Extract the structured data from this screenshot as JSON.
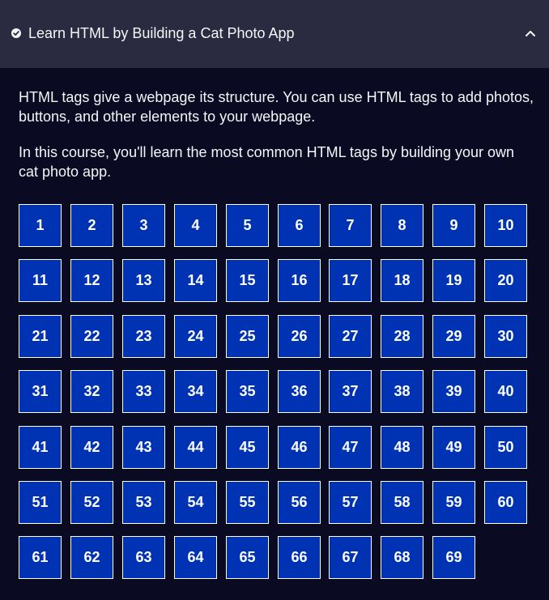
{
  "header": {
    "title": "Learn HTML by Building a Cat Photo App",
    "completed_icon": "check-circle-icon",
    "toggle_icon": "chevron-up-icon"
  },
  "description": {
    "paragraph_1": "HTML tags give a webpage its structure. You can use HTML tags to add photos, buttons, and other elements to your webpage.",
    "paragraph_2": "In this course, you'll learn the most common HTML tags by building your own cat photo app."
  },
  "steps": [
    "1",
    "2",
    "3",
    "4",
    "5",
    "6",
    "7",
    "8",
    "9",
    "10",
    "11",
    "12",
    "13",
    "14",
    "15",
    "16",
    "17",
    "18",
    "19",
    "20",
    "21",
    "22",
    "23",
    "24",
    "25",
    "26",
    "27",
    "28",
    "29",
    "30",
    "31",
    "32",
    "33",
    "34",
    "35",
    "36",
    "37",
    "38",
    "39",
    "40",
    "41",
    "42",
    "43",
    "44",
    "45",
    "46",
    "47",
    "48",
    "49",
    "50",
    "51",
    "52",
    "53",
    "54",
    "55",
    "56",
    "57",
    "58",
    "59",
    "60",
    "61",
    "62",
    "63",
    "64",
    "65",
    "66",
    "67",
    "68",
    "69"
  ],
  "colors": {
    "header_bg": "#2a2a40",
    "body_bg": "#0a0a23",
    "step_bg": "#0033b3",
    "text": "#f5f6f7"
  }
}
